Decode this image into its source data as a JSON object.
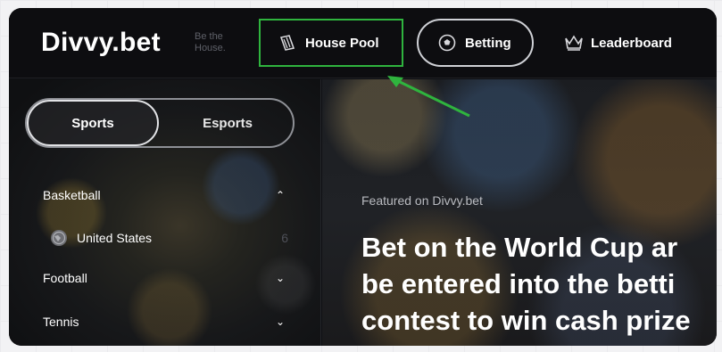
{
  "brand": {
    "logo_text": "Divvy.bet",
    "tagline": "Be the House."
  },
  "nav": {
    "house_pool": "House Pool",
    "betting": "Betting",
    "leaderboard": "Leaderboard"
  },
  "sidebar": {
    "toggle": {
      "sports": "Sports",
      "esports": "Esports"
    },
    "items": [
      {
        "label": "Basketball",
        "chevron": "up"
      },
      {
        "label": "United States",
        "count": "6",
        "icon": "globe-icon"
      },
      {
        "label": "Football",
        "chevron": "down"
      },
      {
        "label": "Tennis",
        "chevron": "down"
      }
    ]
  },
  "main": {
    "featured_label": "Featured on Divvy.bet",
    "headline_lines": [
      "Bet on the World Cup ar",
      "be entered into the betti",
      "contest to win cash prize"
    ]
  },
  "colors": {
    "highlight_green": "#2fb43e",
    "background": "#0d0d10"
  }
}
